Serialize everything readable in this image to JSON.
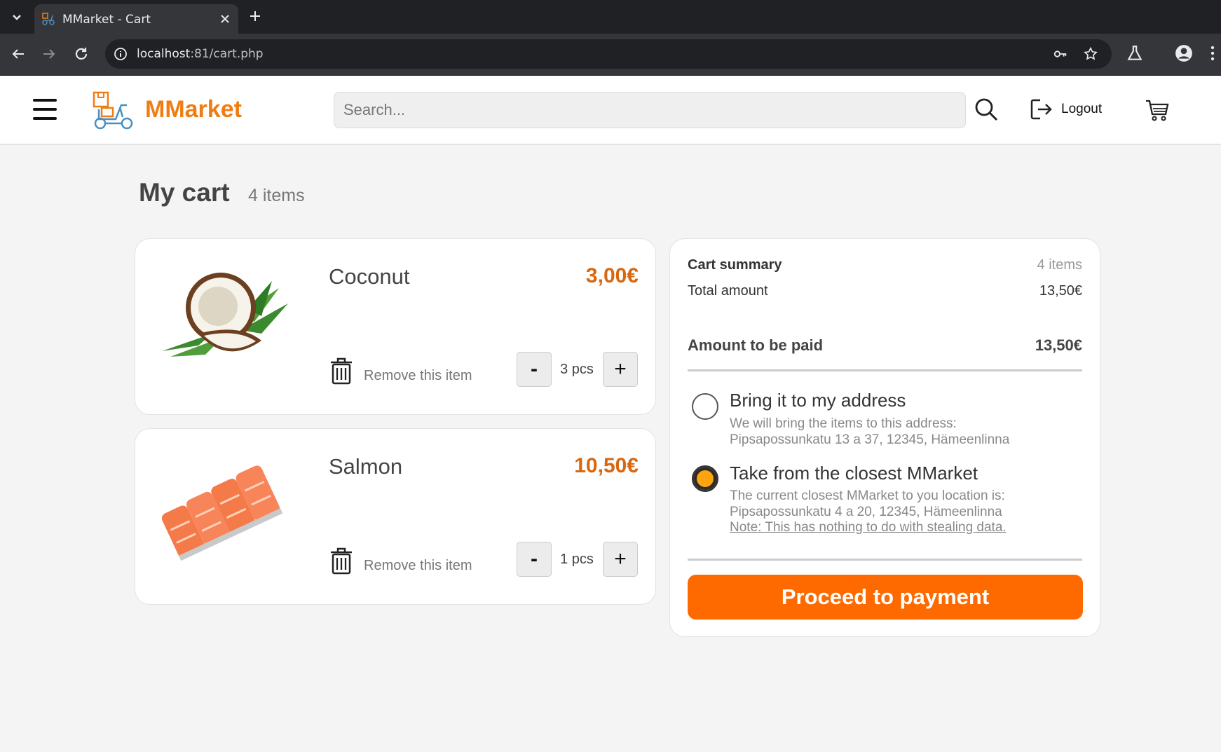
{
  "browser": {
    "tab_title": "MMarket - Cart",
    "url_host": "localhost",
    "url_rest": ":81/cart.php"
  },
  "header": {
    "logo_text": "MMarket",
    "search_placeholder": "Search...",
    "logout_label": "Logout"
  },
  "page": {
    "title": "My cart",
    "count": "4 items"
  },
  "items": [
    {
      "name": "Coconut",
      "price": "3,00€",
      "remove_label": "Remove this item",
      "minus": "-",
      "plus": "+",
      "quantity": "3 pcs"
    },
    {
      "name": "Salmon",
      "price": "10,50€",
      "remove_label": "Remove this item",
      "minus": "-",
      "plus": "+",
      "quantity": "1 pcs"
    }
  ],
  "summary": {
    "title": "Cart summary",
    "count": "4 items",
    "total_label": "Total amount",
    "total_value": "13,50€",
    "pay_label": "Amount to be paid",
    "pay_value": "13,50€",
    "delivery_options": [
      {
        "title": "Bring it to my address",
        "line1": "We will bring the items to this address:",
        "line2": "Pipsapossunkatu 13 a 37, 12345, Hämeenlinna",
        "selected": false
      },
      {
        "title": "Take from the closest MMarket",
        "line1": "The current closest MMarket to you location is:",
        "line2": "Pipsapossunkatu 4 a 20, 12345, Hämeenlinna",
        "note": "Note: This has nothing to do with stealing data.",
        "selected": true
      }
    ],
    "proceed_label": "Proceed to payment"
  },
  "colors": {
    "brand_orange": "#f07d14",
    "price_orange": "#d9670f",
    "button_orange": "#ff6a00"
  }
}
